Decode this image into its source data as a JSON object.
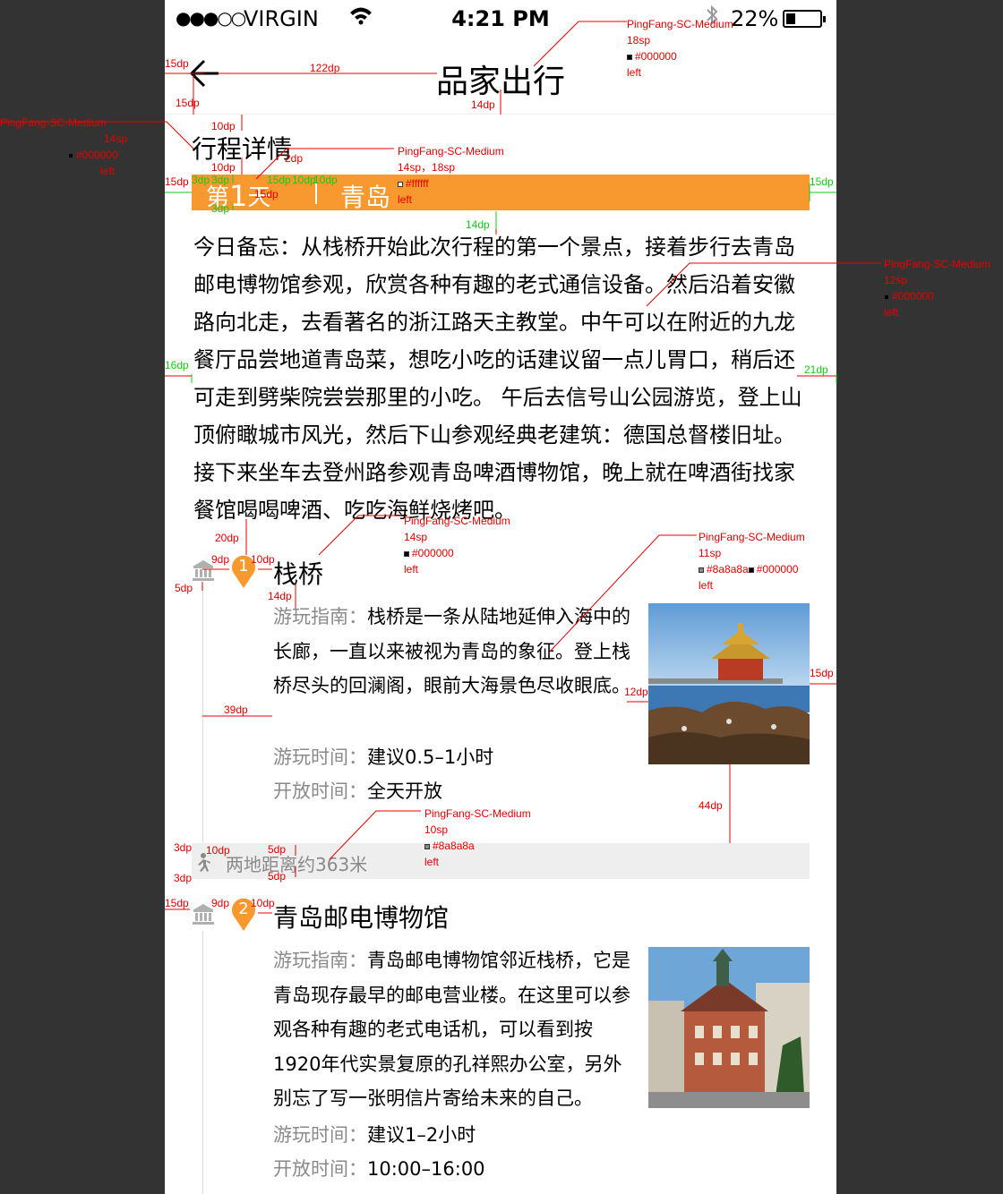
{
  "status_bar": {
    "signal": "●●●○○",
    "carrier": "VIRGIN",
    "time": "4:21 PM",
    "battery": "22%"
  },
  "nav": {
    "title": "品家出行"
  },
  "section_title": "行程详情",
  "day_bar": {
    "prefix": "第",
    "number": "1",
    "suffix": "天",
    "city": "青岛"
  },
  "memo": "今日备忘：从栈桥开始此次行程的第一个景点，接着步行去青岛邮电博物馆参观，欣赏各种有趣的老式通信设备。然后沿着安徽路向北走，去看著名的浙江路天主教堂。中午可以在附近的九龙餐厅品尝地道青岛菜，想吃小吃的话建议留一点儿胃口，稍后还可走到劈柴院尝尝那里的小吃。 午后去信号山公园游览，登上山顶俯瞰城市风光，然后下山参观经典老建筑：德国总督楼旧址。接下来坐车去登州路参观青岛啤酒博物馆，晚上就在啤酒街找家餐馆喝喝啤酒、吃吃海鲜烧烤吧。",
  "spots": [
    {
      "index": "1",
      "name": "栈桥",
      "guide_label": "游玩指南：",
      "guide": "栈桥是一条从陆地延伸入海中的长廊，一直以来被视为青岛的象征。登上栈桥尽头的回澜阁，眼前大海景色尽收眼底。",
      "time_label": "游玩时间：",
      "time": "建议0.5–1小时",
      "open_label": "开放时间：",
      "open": "全天开放"
    },
    {
      "index": "2",
      "name": "青岛邮电博物馆",
      "guide_label": "游玩指南：",
      "guide": "青岛邮电博物馆邻近栈桥，它是青岛现存最早的邮电营业楼。在这里可以参观各种有趣的老式电话机，可以看到按1920年代实景复原的孔祥熙办公室，另外别忘了写一张明信片寄给未来的自己。",
      "time_label": "游玩时间：",
      "time": "建议1–2小时",
      "open_label": "开放时间：",
      "open": "10:00–16:00"
    }
  ],
  "distance": "两地距离约363米",
  "colors": {
    "accent": "#f7992f",
    "label_gray": "#8a8a8a",
    "text_black": "#000000",
    "distance_bg": "#eeeeee",
    "annotation_red": "#e60000",
    "annotation_green": "#11cc11"
  },
  "icons": [
    "back-arrow-icon",
    "wifi-icon",
    "bluetooth-icon",
    "battery-icon",
    "landmark-icon",
    "map-pin-icon",
    "walk-icon"
  ],
  "annotations": {
    "nav_title_spec": {
      "font": "PingFang-SC-Medium",
      "size": "18sp",
      "color": "#000000",
      "align": "left"
    },
    "section_title_spec": {
      "font": "PingFang-SC-Medium",
      "size": "14sp",
      "color": "#000000",
      "align": "left"
    },
    "day_bar_spec": {
      "font": "PingFang-SC-Medium",
      "size": "14sp，18sp",
      "color": "#ffffff",
      "align": "left"
    },
    "memo_spec": {
      "font": "PingFang-SC-Medium",
      "size": "12sp",
      "color": "#000000",
      "align": "left"
    },
    "spot_title_spec": {
      "font": "PingFang-SC-Medium",
      "size": "14sp",
      "color": "#000000",
      "align": "left"
    },
    "spot_text_spec": {
      "font": "PingFang-SC-Medium",
      "size": "11sp",
      "color": "#8a8a8a",
      "color2": "#000000",
      "align": "left"
    },
    "distance_spec": {
      "font": "PingFang-SC-Medium",
      "size": "10sp",
      "color": "#8a8a8a",
      "align": "left"
    },
    "dims": {
      "d15_a": "15dp",
      "d122": "122dp",
      "d15_b": "15dp",
      "d14_a": "14dp",
      "d10_a": "10dp",
      "d10_b": "10dp",
      "d2": "2dp",
      "d15_c": "15dp",
      "d15_d": "15dp",
      "d14_b": "14dp",
      "d16": "16dp",
      "d21": "21dp",
      "d20": "20dp",
      "d9_a": "9dp",
      "d10_c": "10dp",
      "d5_a": "5dp",
      "d14_c": "14dp",
      "d39": "39dp",
      "d12": "12dp",
      "d15_e": "15dp",
      "d44": "44dp",
      "d3_a": "3dp",
      "d10_d": "10dp",
      "d5_b": "5dp",
      "d5_c": "5dp",
      "d3_b": "3dp",
      "d15_f": "15dp",
      "d9_b": "9dp",
      "d10_e": "10dp",
      "g3_a": "3dp",
      "g3_b": "3dp",
      "g15": "15dp",
      "g10": "10dp",
      "g10b": "10dp",
      "g3_c": "3dp",
      "g15b": "15dp"
    }
  }
}
